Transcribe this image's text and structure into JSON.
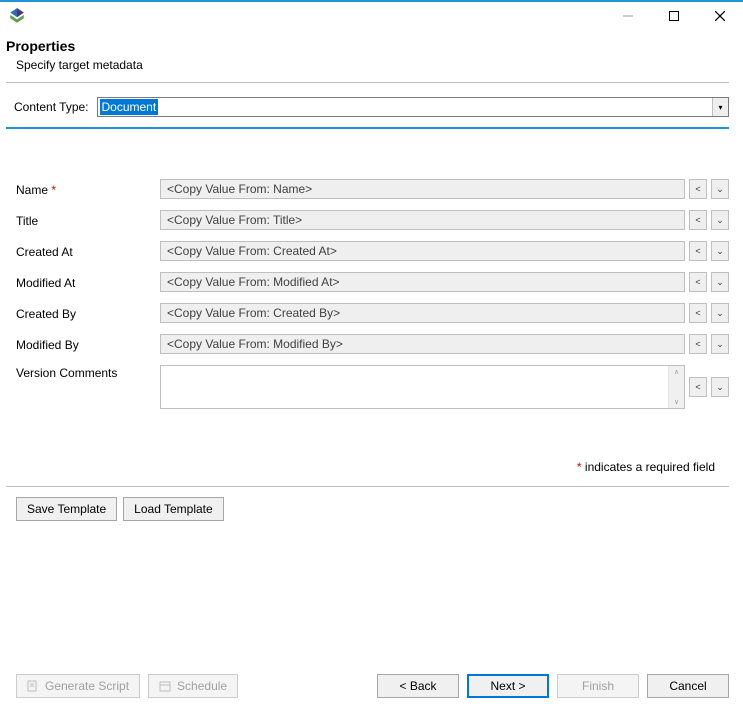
{
  "window": {
    "minimize_glyph": "—",
    "maximize_glyph": "□",
    "close_glyph": "✕"
  },
  "header": {
    "title": "Properties",
    "subtitle": "Specify target metadata"
  },
  "content_type": {
    "label": "Content Type:",
    "selected": "Document"
  },
  "fields": [
    {
      "label": "Name",
      "required": true,
      "value": "<Copy Value From: Name>"
    },
    {
      "label": "Title",
      "required": false,
      "value": "<Copy Value From: Title>"
    },
    {
      "label": "Created At",
      "required": false,
      "value": "<Copy Value From: Created At>"
    },
    {
      "label": "Modified At",
      "required": false,
      "value": "<Copy Value From: Modified At>"
    },
    {
      "label": "Created By",
      "required": false,
      "value": "<Copy Value From: Created By>"
    },
    {
      "label": "Modified By",
      "required": false,
      "value": "<Copy Value From: Modified By>"
    }
  ],
  "comments": {
    "label": "Version Comments",
    "value": ""
  },
  "required_note": {
    "star": "*",
    "text": " indicates a required field"
  },
  "template_buttons": {
    "save": "Save Template",
    "load": "Load Template"
  },
  "wizard": {
    "generate": "Generate Script",
    "schedule": "Schedule",
    "back": "< Back",
    "next": "Next >",
    "finish": "Finish",
    "cancel": "Cancel"
  }
}
